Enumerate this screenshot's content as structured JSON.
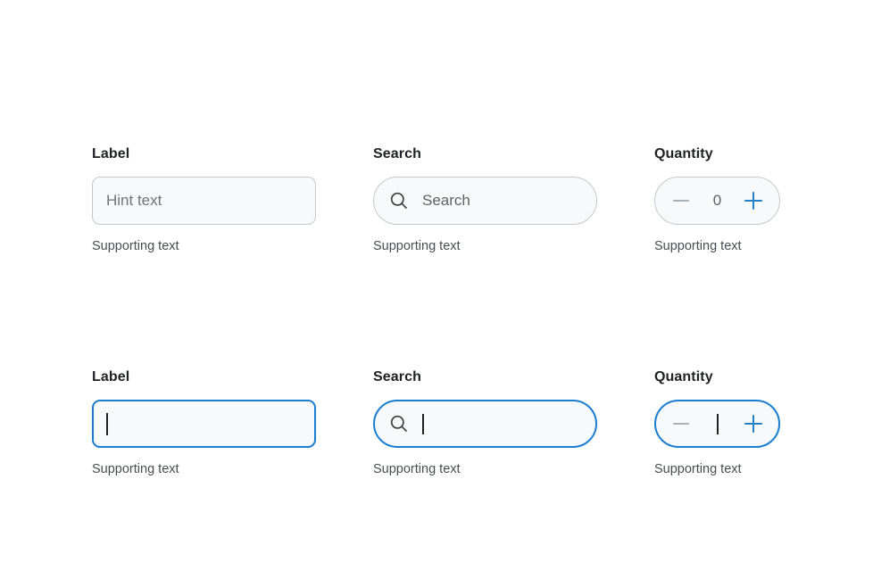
{
  "colors": {
    "background": "#ffffff",
    "field_background": "#f8f9fa",
    "border_default": "#c5c9cd",
    "border_focused": "#1a7ed0",
    "accent_blue": "#2080c8",
    "label_text": "#202124",
    "supporting_text": "#494d52",
    "hint_text": "#6f757a",
    "value_text": "#5f6368",
    "disabled_icon": "#a9afb5",
    "caret": "#202124"
  },
  "rows": [
    {
      "state": "default",
      "text_field": {
        "label": "Label",
        "placeholder": "Hint text",
        "value": "",
        "supporting_text": "Supporting text"
      },
      "search_field": {
        "label": "Search",
        "icon": "search-icon",
        "placeholder": "Search",
        "value": "",
        "supporting_text": "Supporting text"
      },
      "quantity_field": {
        "label": "Quantity",
        "decrement_icon": "minus-icon",
        "increment_icon": "plus-icon",
        "value": "0",
        "supporting_text": "Supporting text"
      }
    },
    {
      "state": "focused",
      "text_field": {
        "label": "Label",
        "placeholder": "",
        "value": "",
        "supporting_text": "Supporting text"
      },
      "search_field": {
        "label": "Search",
        "icon": "search-icon",
        "placeholder": "",
        "value": "",
        "supporting_text": "Supporting text"
      },
      "quantity_field": {
        "label": "Quantity",
        "decrement_icon": "minus-icon",
        "increment_icon": "plus-icon",
        "value": "",
        "supporting_text": "Supporting text"
      }
    }
  ]
}
